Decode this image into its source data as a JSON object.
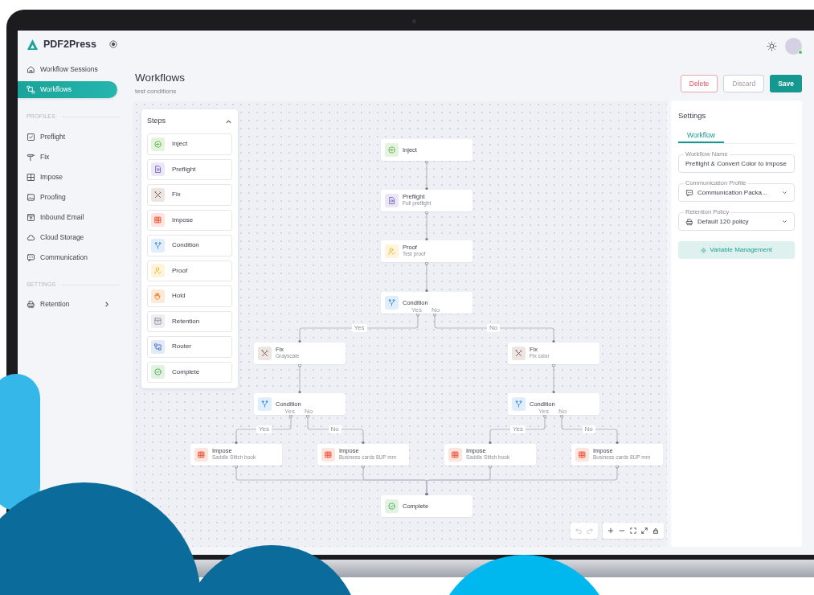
{
  "app": {
    "name": "PDF2Press"
  },
  "sidebar": {
    "nav": [
      {
        "label": "Workflow Sessions",
        "selected": false
      },
      {
        "label": "Workflows",
        "selected": true
      }
    ],
    "sections": [
      {
        "title": "PROFILES",
        "items": [
          {
            "label": "Preflight"
          },
          {
            "label": "Fix"
          },
          {
            "label": "Impose"
          },
          {
            "label": "Proofing"
          },
          {
            "label": "Inbound Email"
          },
          {
            "label": "Cloud Storage"
          },
          {
            "label": "Communication"
          }
        ]
      },
      {
        "title": "SETTINGS",
        "items": [
          {
            "label": "Retention",
            "submenu": true
          }
        ]
      }
    ]
  },
  "header": {
    "title": "Workflows",
    "subtitle": "test conditions",
    "buttons": [
      {
        "label": "Delete",
        "kind": "danger"
      },
      {
        "label": "Discard",
        "kind": "neutral"
      },
      {
        "label": "Save",
        "kind": "primary"
      }
    ]
  },
  "steps": {
    "title": "Steps",
    "expanded": true,
    "items": [
      {
        "kind": "inject",
        "label": "Inject"
      },
      {
        "kind": "preflight",
        "label": "Preflight"
      },
      {
        "kind": "fix",
        "label": "Fix"
      },
      {
        "kind": "impose",
        "label": "Impose"
      },
      {
        "kind": "condition",
        "label": "Condition"
      },
      {
        "kind": "proof",
        "label": "Proof"
      },
      {
        "kind": "hold",
        "label": "Hold"
      },
      {
        "kind": "retention",
        "label": "Retention"
      },
      {
        "kind": "router",
        "label": "Router"
      },
      {
        "kind": "complete",
        "label": "Complete"
      }
    ]
  },
  "canvas": {
    "nodes": [
      {
        "kind": "inject",
        "title": "Inject"
      },
      {
        "kind": "preflight",
        "title": "Preflight",
        "subtitle": "Full preflight"
      },
      {
        "kind": "proof",
        "title": "Proof",
        "subtitle": "Test proof"
      },
      {
        "kind": "condition",
        "title": "Condition",
        "ports": [
          "Yes",
          "No"
        ]
      },
      {
        "kind": "fix",
        "title": "Fix",
        "subtitle": "Grayscale"
      },
      {
        "kind": "fix",
        "title": "Fix",
        "subtitle": "Fix color"
      },
      {
        "kind": "condition",
        "title": "Condition",
        "ports": [
          "Yes",
          "No"
        ]
      },
      {
        "kind": "condition",
        "title": "Condition",
        "ports": [
          "Yes",
          "No"
        ]
      },
      {
        "kind": "impose",
        "title": "Impose",
        "subtitle": "Saddle Stitch book"
      },
      {
        "kind": "impose",
        "title": "Impose",
        "subtitle": "Business cards 8UP mm"
      },
      {
        "kind": "impose",
        "title": "Impose",
        "subtitle": "Saddle Stitch book"
      },
      {
        "kind": "impose",
        "title": "Impose",
        "subtitle": "Business cards 8UP mm"
      },
      {
        "kind": "complete",
        "title": "Complete"
      }
    ],
    "edge_labels": [
      "Yes",
      "No",
      "Yes",
      "No",
      "Yes",
      "No"
    ]
  },
  "settings": {
    "title": "Settings",
    "tabs": [
      {
        "label": "Workflow",
        "selected": true
      }
    ],
    "fields": [
      {
        "kind": "text",
        "label": "Workflow Name",
        "value": "Preflight & Convert Color to Impose"
      },
      {
        "kind": "select",
        "label": "Communication Profile",
        "value": "Communication Packa..."
      },
      {
        "kind": "select",
        "label": "Retention Policy",
        "value": "Default 120 policy"
      }
    ],
    "action": "Variable Management"
  }
}
